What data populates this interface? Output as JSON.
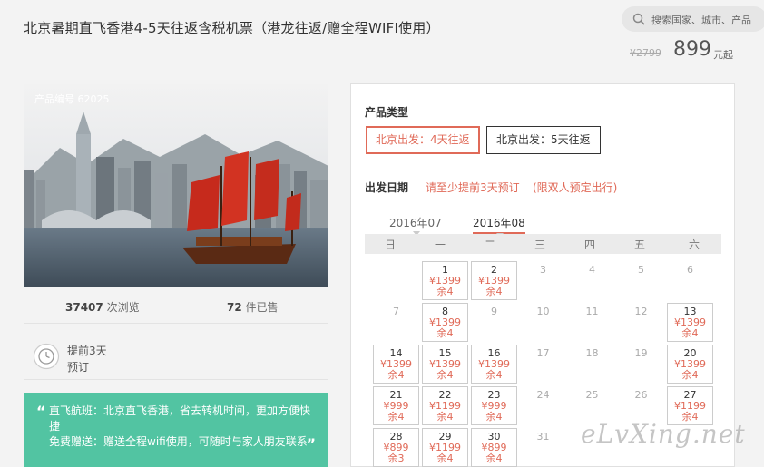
{
  "header": {
    "title": "北京暑期直飞香港4-5天往返含税机票（港龙往返/赠全程WIFI使用）",
    "search_placeholder": "搜索国家、城市、产品",
    "old_price": "¥2799",
    "price": "899",
    "price_unit": "元起"
  },
  "product": {
    "code": "产品编号 62025",
    "views_count": "37407",
    "views_label": "次浏览",
    "sold_count": "72",
    "sold_label": "件已售",
    "advance_line1": "提前3天",
    "advance_line2": "预订",
    "promo_line1": "直飞航班：北京直飞香港，省去转机时间，更加方便快捷",
    "promo_line2": "免费赠送：赠送全程wifi使用，可随时与家人朋友联系"
  },
  "booking": {
    "product_type_label": "产品类型",
    "options": [
      {
        "label": "北京出发：4天往返",
        "active": true
      },
      {
        "label": "北京出发：5天往返",
        "active": false
      }
    ],
    "date_label": "出发日期",
    "notice1": "请至少提前3天预订",
    "notice2": "(限双人预定出行)",
    "months": [
      "2016年07",
      "2016年08"
    ],
    "active_month": "2016年08",
    "weekdays": [
      "日",
      "一",
      "二",
      "三",
      "四",
      "五",
      "六"
    ],
    "days": [
      {
        "day": "1",
        "col": 1,
        "row": 0,
        "price": "¥1399",
        "stock": "余4"
      },
      {
        "day": "2",
        "col": 2,
        "row": 0,
        "price": "¥1399",
        "stock": "余4"
      },
      {
        "day": "3",
        "col": 3,
        "row": 0
      },
      {
        "day": "4",
        "col": 4,
        "row": 0
      },
      {
        "day": "5",
        "col": 5,
        "row": 0
      },
      {
        "day": "6",
        "col": 6,
        "row": 0
      },
      {
        "day": "7",
        "col": 0,
        "row": 1
      },
      {
        "day": "8",
        "col": 1,
        "row": 1,
        "price": "¥1399",
        "stock": "余4"
      },
      {
        "day": "9",
        "col": 2,
        "row": 1
      },
      {
        "day": "10",
        "col": 3,
        "row": 1
      },
      {
        "day": "11",
        "col": 4,
        "row": 1
      },
      {
        "day": "12",
        "col": 5,
        "row": 1
      },
      {
        "day": "13",
        "col": 6,
        "row": 1,
        "price": "¥1399",
        "stock": "余4"
      },
      {
        "day": "14",
        "col": 0,
        "row": 2,
        "price": "¥1399",
        "stock": "余4"
      },
      {
        "day": "15",
        "col": 1,
        "row": 2,
        "price": "¥1399",
        "stock": "余4"
      },
      {
        "day": "16",
        "col": 2,
        "row": 2,
        "price": "¥1399",
        "stock": "余4"
      },
      {
        "day": "17",
        "col": 3,
        "row": 2
      },
      {
        "day": "18",
        "col": 4,
        "row": 2
      },
      {
        "day": "19",
        "col": 5,
        "row": 2
      },
      {
        "day": "20",
        "col": 6,
        "row": 2,
        "price": "¥1399",
        "stock": "余4"
      },
      {
        "day": "21",
        "col": 0,
        "row": 3,
        "price": "¥999",
        "stock": "余4"
      },
      {
        "day": "22",
        "col": 1,
        "row": 3,
        "price": "¥1199",
        "stock": "余4"
      },
      {
        "day": "23",
        "col": 2,
        "row": 3,
        "price": "¥999",
        "stock": "余4"
      },
      {
        "day": "24",
        "col": 3,
        "row": 3
      },
      {
        "day": "25",
        "col": 4,
        "row": 3
      },
      {
        "day": "26",
        "col": 5,
        "row": 3
      },
      {
        "day": "27",
        "col": 6,
        "row": 3,
        "price": "¥1199",
        "stock": "余4"
      },
      {
        "day": "28",
        "col": 0,
        "row": 4,
        "price": "¥899",
        "stock": "余3"
      },
      {
        "day": "29",
        "col": 1,
        "row": 4,
        "price": "¥1199",
        "stock": "余4"
      },
      {
        "day": "30",
        "col": 2,
        "row": 4,
        "price": "¥899",
        "stock": "余4"
      },
      {
        "day": "31",
        "col": 3,
        "row": 4
      }
    ]
  },
  "watermark": "eLvXing.net",
  "colors": {
    "accent": "#e06a58",
    "promo_bg": "#52c4a2"
  }
}
